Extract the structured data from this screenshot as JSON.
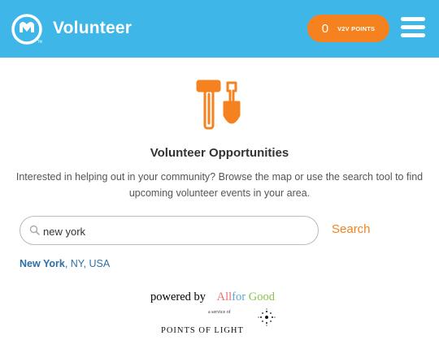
{
  "header": {
    "title": "Volunteer",
    "points_count": "0",
    "points_label": "V2V POINTS",
    "logo_icon": "volunteer-logo-icon",
    "menu_icon": "hamburger-menu-icon",
    "background_color": "#3fb6e8",
    "accent_color": "#f5821f"
  },
  "main": {
    "icon": "hammer-shovel-icon",
    "heading": "Volunteer Opportunities",
    "intro": "Interested in helping out in your community? Browse the map or use the search tool to find upcoming volunteer events in your area.",
    "search": {
      "value": "new york",
      "placeholder": "",
      "button_label": "Search"
    },
    "result": {
      "city": "New York",
      "rest": ", NY, USA"
    }
  },
  "footer": {
    "powered_by": "powered by",
    "brand_part1": "All",
    "brand_part2": "for",
    "brand_part3": "Good",
    "service": "a service of",
    "org": "POINTS OF LIGHT"
  }
}
